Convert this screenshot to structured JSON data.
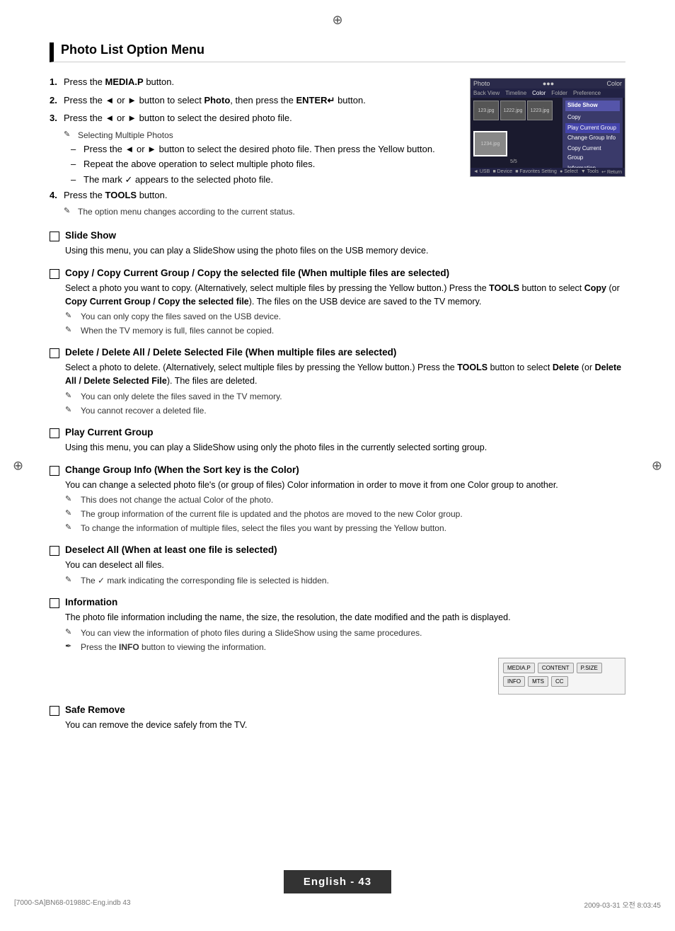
{
  "page": {
    "title": "Photo List Option Menu",
    "corner_symbol": "⊕",
    "bottom_file_left": "[7000-SA]BN68-01988C-Eng.indb   43",
    "bottom_file_right": "2009-03-31   오전 8:03:45",
    "page_label": "English - 43"
  },
  "steps": [
    {
      "num": "1.",
      "text": "Press the ",
      "bold": "MEDIA.P",
      "rest": " button."
    },
    {
      "num": "2.",
      "text": "Press the ◄ or ► button to select ",
      "bold": "Photo",
      "rest": ", then press the ",
      "bold2": "ENTER",
      "rest2": " button."
    },
    {
      "num": "3.",
      "text": "Press the ◄ or ► button to select the desired photo file."
    },
    {
      "num": "",
      "text": "Selecting Multiple Photos",
      "indent": true
    },
    {
      "num": "–",
      "text": "Press the ◄ or ► button to select the desired photo file. Then press the Yellow button.",
      "sub": true
    },
    {
      "num": "–",
      "text": "Repeat the above operation to select multiple photo files.",
      "sub": true
    },
    {
      "num": "–",
      "text": "The mark ✓ appears to the selected photo file.",
      "sub": true
    },
    {
      "num": "4.",
      "text": "Press the ",
      "bold": "TOOLS",
      "rest": " button."
    },
    {
      "num": "",
      "text": "The option menu changes according to the current status.",
      "note": true
    }
  ],
  "screen": {
    "top_bar_left": "Photo",
    "top_bar_right": "Color",
    "nav_items": [
      "Back View",
      "Timeline",
      "Color",
      "Folder",
      "Preference"
    ],
    "active_nav": "Color",
    "thumbs": [
      "123.jpg",
      "1222.jpg",
      "1223.jpg",
      "1234.jpg"
    ],
    "menu_title": "Slide Show",
    "menu_items": [
      "Copy",
      "Play Current Group",
      "Change Group Info",
      "Copy Current Group",
      "Information"
    ],
    "count": "5/5",
    "bottom": [
      "◄ USB",
      "■ Device",
      "■ Favorites Setting",
      "● Select",
      "▼ Tools",
      "↩ Return"
    ]
  },
  "options": [
    {
      "id": "slide-show",
      "title": "Slide Show",
      "body": "Using this menu, you can play a SlideShow using the photo files on the USB memory device.",
      "notes": []
    },
    {
      "id": "copy",
      "title": "Copy / Copy Current Group / Copy the selected file (When multiple files are selected)",
      "body": "Select a photo you want to copy. (Alternatively, select multiple files by pressing the Yellow button.) Press the TOOLS button to select Copy (or Copy Current Group / Copy the selected file). The files on the USB device are saved to the TV memory.",
      "notes": [
        {
          "sym": "✎",
          "text": "You can only copy the files saved on the USB device."
        },
        {
          "sym": "✎",
          "text": "When the TV memory is full, files cannot be copied."
        }
      ]
    },
    {
      "id": "delete",
      "title": "Delete / Delete All / Delete Selected File (When multiple files are selected)",
      "body": "Select a photo to delete. (Alternatively, select multiple files by pressing the Yellow button.) Press the TOOLS button to select Delete (or Delete All / Delete Selected File). The files are deleted.",
      "notes": [
        {
          "sym": "✎",
          "text": "You can only delete the files saved in the TV memory."
        },
        {
          "sym": "✎",
          "text": "You cannot recover a deleted file."
        }
      ]
    },
    {
      "id": "play-current-group",
      "title": "Play Current Group",
      "body": "Using this menu, you can play a SlideShow using only the photo files in the currently selected sorting group.",
      "notes": []
    },
    {
      "id": "change-group-info",
      "title": "Change Group Info (When the Sort key is the Color)",
      "body": "You can change a selected photo file's (or group of files) Color information in order to move it from one Color group to another.",
      "notes": [
        {
          "sym": "✎",
          "text": "This does not change the actual Color of the photo."
        },
        {
          "sym": "✎",
          "text": "The group information of the current file is updated and the photos are moved to the new Color group."
        },
        {
          "sym": "✎",
          "text": "To change the information of multiple files, select the files you want by pressing the Yellow button."
        }
      ]
    },
    {
      "id": "deselect-all",
      "title": "Deselect All (When at least one file is selected)",
      "body": "You can deselect all files.",
      "notes": [
        {
          "sym": "✎",
          "text": "The ✓ mark indicating the corresponding file is selected is hidden."
        }
      ]
    },
    {
      "id": "information",
      "title": "Information",
      "body": "The photo file information including the name, the size, the resolution, the date modified and the path is displayed.",
      "notes": [
        {
          "sym": "✎",
          "text": "You can view the information of photo files during a SlideShow using the same procedures."
        },
        {
          "sym": "✒",
          "text": "Press the INFO button to viewing the information."
        }
      ]
    },
    {
      "id": "safe-remove",
      "title": "Safe Remove",
      "body": "You can remove the device safely from the TV.",
      "notes": []
    }
  ],
  "remote": {
    "row1": [
      "MEDIA.P",
      "CONTENT",
      "P.SIZE"
    ],
    "row2": [
      "INFO",
      "MTS",
      "CC"
    ]
  }
}
